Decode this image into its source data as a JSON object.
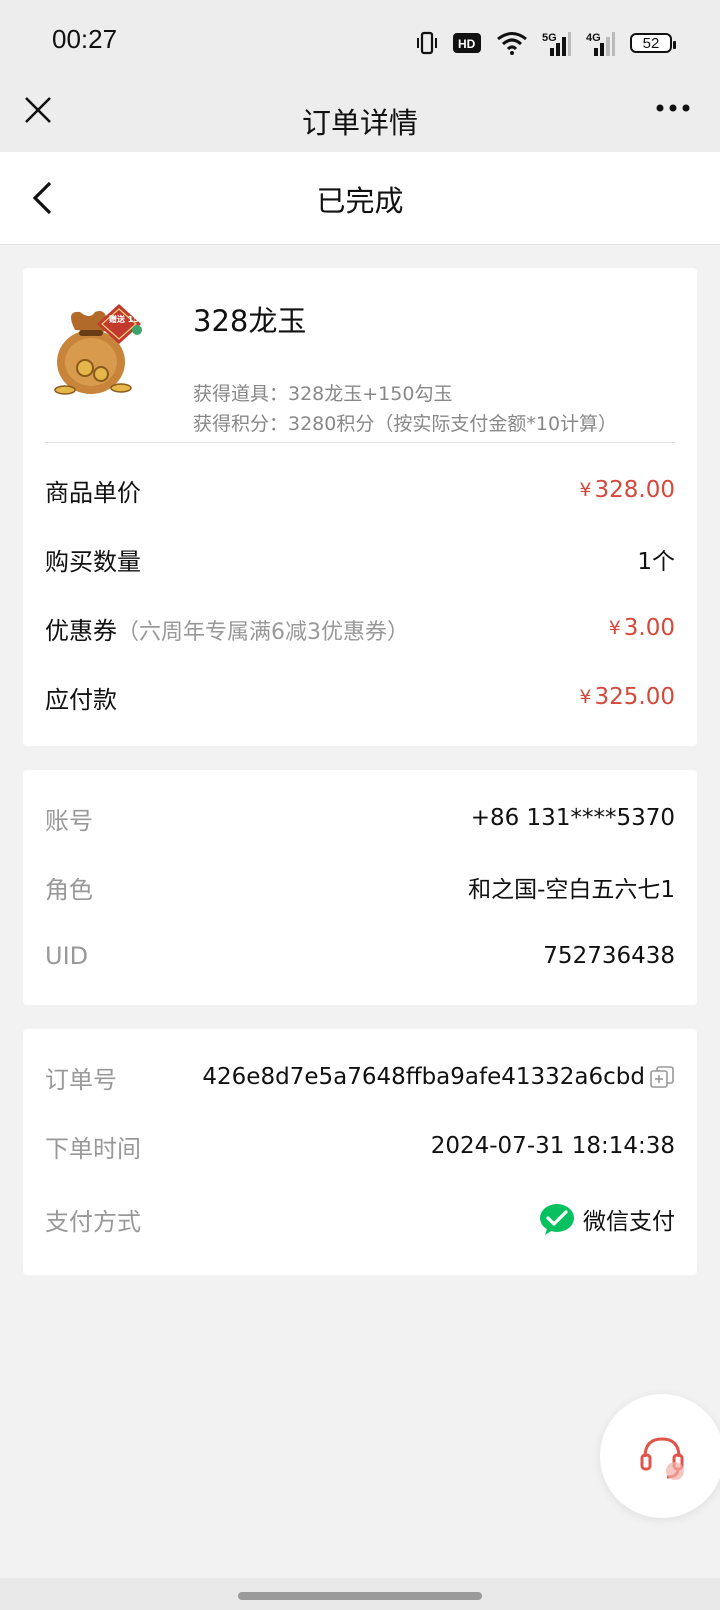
{
  "status_bar": {
    "time": "00:27",
    "hd_label": "HD",
    "network_5g": "5G",
    "network_4g": "4G",
    "battery": "52"
  },
  "wechat_nav": {
    "title": "订单详情"
  },
  "page_nav": {
    "title": "已完成"
  },
  "product": {
    "image_badge": "赠送 150",
    "name": "328龙玉",
    "items_line": "获得道具：328龙玉+150勾玉",
    "points_line": "获得积分：3280积分（按实际支付金额*10计算）"
  },
  "price_rows": {
    "unit_price": {
      "label": "商品单价",
      "currency": "¥",
      "value": "328.00"
    },
    "quantity": {
      "label": "购买数量",
      "value": "1个"
    },
    "coupon": {
      "label": "优惠券",
      "note": "（六周年专属满6减3优惠券）",
      "currency": "¥",
      "value": "3.00"
    },
    "payable": {
      "label": "应付款",
      "currency": "¥",
      "value": "325.00"
    }
  },
  "account": {
    "account_label": "账号",
    "account_value": "+86 131****5370",
    "role_label": "角色",
    "role_value": "和之国-空白五六七1",
    "uid_label": "UID",
    "uid_value": "752736438"
  },
  "order": {
    "order_no_label": "订单号",
    "order_no_value": "426e8d7e5a7648ffba9afe41332a6cbd",
    "time_label": "下单时间",
    "time_value": "2024-07-31 18:14:38",
    "payment_label": "支付方式",
    "payment_value": "微信支付"
  },
  "colors": {
    "price_red": "#d4493b",
    "wechat_green": "#07c160",
    "page_bg": "#f2f2f2"
  }
}
